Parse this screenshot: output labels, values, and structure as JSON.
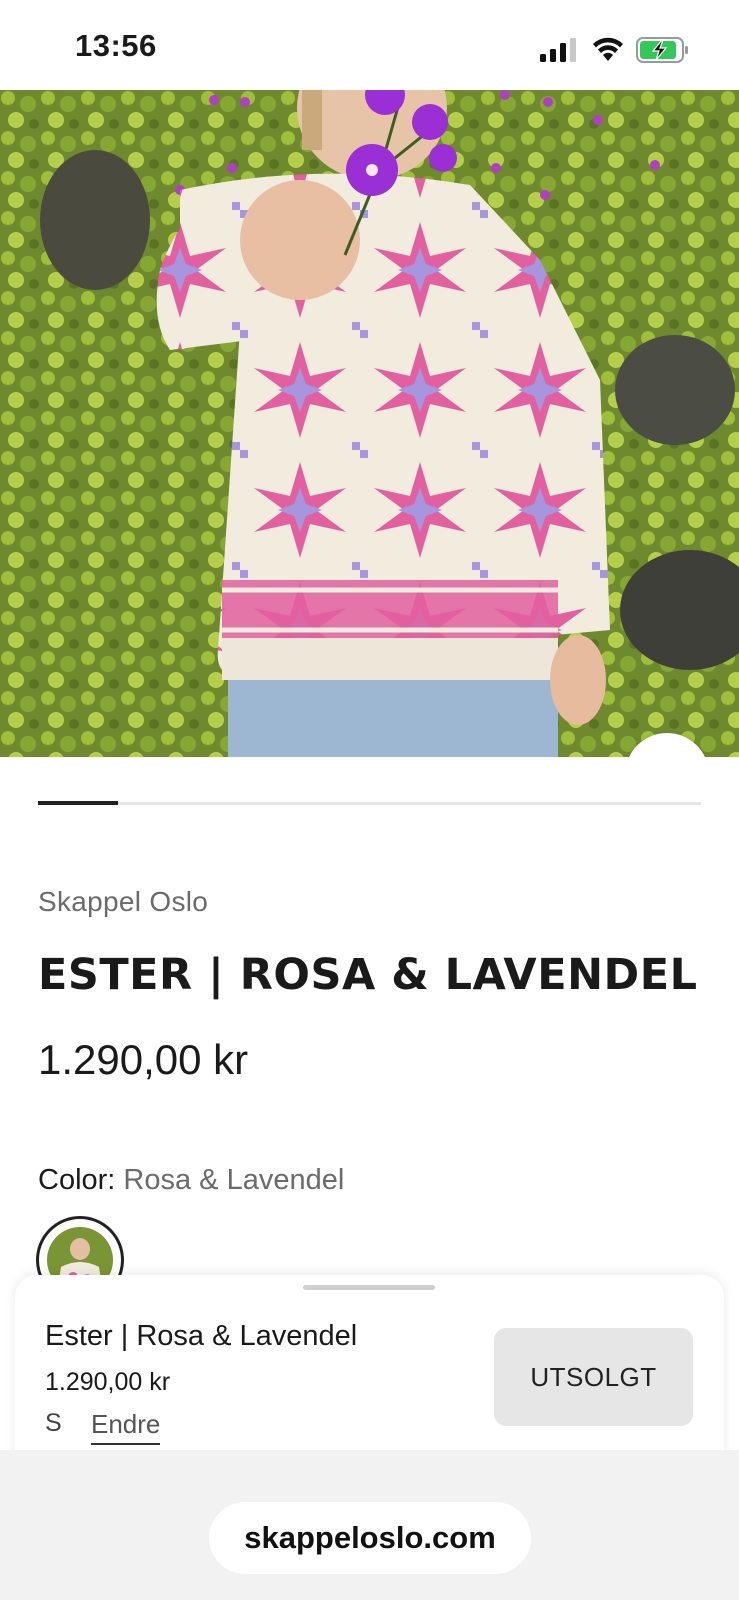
{
  "status_bar": {
    "time": "13:56",
    "icons": [
      "signal-icon",
      "wifi-icon",
      "battery-charging-icon"
    ]
  },
  "hero": {
    "image": "product-photo-knit-sweater",
    "zoom_icon": "zoom-in-icon"
  },
  "gallery": {
    "progress": 0.12
  },
  "product": {
    "vendor": "Skappel Oslo",
    "title": "ESTER | ROSA & LAVENDEL",
    "price": "1.290,00 kr",
    "color_label": "Color:",
    "color_value": "Rosa & Lavendel"
  },
  "sticky_bar": {
    "title": "Ester | Rosa & Lavendel",
    "price": "1.290,00 kr",
    "size": "S",
    "change_label": "Endre",
    "button_label": "UTSOLGT"
  },
  "browser": {
    "url": "skappeloslo.com"
  },
  "colors": {
    "accent_dark": "#222222",
    "button_bg": "#e6e6e6",
    "muted_text": "#6b6b6b",
    "pink": "#e2609f",
    "lavender": "#a795dd",
    "cream": "#f3efe3"
  }
}
